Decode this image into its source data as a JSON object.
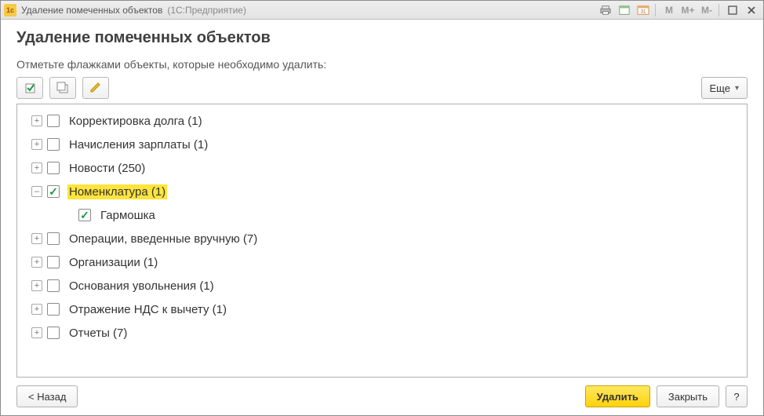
{
  "window": {
    "title": "Удаление помеченных объектов",
    "subtitle": "(1С:Предприятие)"
  },
  "titlebar_icons": {
    "print": "print-icon",
    "calendar": "calendar-icon",
    "calendar31": "calendar-31-icon",
    "m": "M",
    "mplus": "M+",
    "mminus": "M-",
    "maximize": "maximize-icon",
    "close": "close-icon"
  },
  "page": {
    "title": "Удаление помеченных объектов",
    "instruction": "Отметьте флажками объекты, которые необходимо удалить:",
    "more_label": "Еще"
  },
  "toolbar": {
    "check_all": "check-all",
    "uncheck_all": "uncheck-all",
    "edit": "edit"
  },
  "tree": {
    "items": [
      {
        "label": "Корректировка долга (1)",
        "expanded": false,
        "checked": false,
        "highlight": false
      },
      {
        "label": "Начисления зарплаты (1)",
        "expanded": false,
        "checked": false,
        "highlight": false
      },
      {
        "label": "Новости (250)",
        "expanded": false,
        "checked": false,
        "highlight": false
      },
      {
        "label": "Номенклатура (1)",
        "expanded": true,
        "checked": true,
        "highlight": true,
        "children": [
          {
            "label": "Гармошка",
            "checked": true
          }
        ]
      },
      {
        "label": "Операции, введенные вручную (7)",
        "expanded": false,
        "checked": false,
        "highlight": false
      },
      {
        "label": "Организации (1)",
        "expanded": false,
        "checked": false,
        "highlight": false
      },
      {
        "label": "Основания увольнения (1)",
        "expanded": false,
        "checked": false,
        "highlight": false
      },
      {
        "label": "Отражение НДС к вычету (1)",
        "expanded": false,
        "checked": false,
        "highlight": false
      },
      {
        "label": "Отчеты (7)",
        "expanded": false,
        "checked": false,
        "highlight": false
      }
    ]
  },
  "footer": {
    "back": "< Назад",
    "delete": "Удалить",
    "close": "Закрыть",
    "help": "?"
  }
}
